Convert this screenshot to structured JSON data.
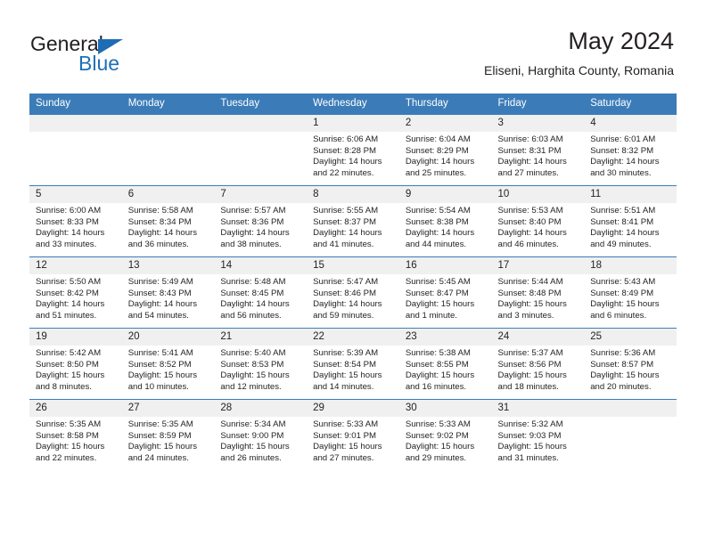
{
  "brand": {
    "name_top": "General",
    "name_bottom": "Blue"
  },
  "header": {
    "title": "May 2024",
    "subtitle": "Eliseni, Harghita County, Romania"
  },
  "colors": {
    "header_blue": "#3b7cb8",
    "brand_blue": "#1e6cb4",
    "daynum_bg": "#f0f0f0",
    "text": "#231f20"
  },
  "weekdays": [
    "Sunday",
    "Monday",
    "Tuesday",
    "Wednesday",
    "Thursday",
    "Friday",
    "Saturday"
  ],
  "weeks": [
    [
      {
        "day": "",
        "sunrise": "",
        "sunset": "",
        "daylight": "",
        "daylight2": ""
      },
      {
        "day": "",
        "sunrise": "",
        "sunset": "",
        "daylight": "",
        "daylight2": ""
      },
      {
        "day": "",
        "sunrise": "",
        "sunset": "",
        "daylight": "",
        "daylight2": ""
      },
      {
        "day": "1",
        "sunrise": "Sunrise: 6:06 AM",
        "sunset": "Sunset: 8:28 PM",
        "daylight": "Daylight: 14 hours",
        "daylight2": "and 22 minutes."
      },
      {
        "day": "2",
        "sunrise": "Sunrise: 6:04 AM",
        "sunset": "Sunset: 8:29 PM",
        "daylight": "Daylight: 14 hours",
        "daylight2": "and 25 minutes."
      },
      {
        "day": "3",
        "sunrise": "Sunrise: 6:03 AM",
        "sunset": "Sunset: 8:31 PM",
        "daylight": "Daylight: 14 hours",
        "daylight2": "and 27 minutes."
      },
      {
        "day": "4",
        "sunrise": "Sunrise: 6:01 AM",
        "sunset": "Sunset: 8:32 PM",
        "daylight": "Daylight: 14 hours",
        "daylight2": "and 30 minutes."
      }
    ],
    [
      {
        "day": "5",
        "sunrise": "Sunrise: 6:00 AM",
        "sunset": "Sunset: 8:33 PM",
        "daylight": "Daylight: 14 hours",
        "daylight2": "and 33 minutes."
      },
      {
        "day": "6",
        "sunrise": "Sunrise: 5:58 AM",
        "sunset": "Sunset: 8:34 PM",
        "daylight": "Daylight: 14 hours",
        "daylight2": "and 36 minutes."
      },
      {
        "day": "7",
        "sunrise": "Sunrise: 5:57 AM",
        "sunset": "Sunset: 8:36 PM",
        "daylight": "Daylight: 14 hours",
        "daylight2": "and 38 minutes."
      },
      {
        "day": "8",
        "sunrise": "Sunrise: 5:55 AM",
        "sunset": "Sunset: 8:37 PM",
        "daylight": "Daylight: 14 hours",
        "daylight2": "and 41 minutes."
      },
      {
        "day": "9",
        "sunrise": "Sunrise: 5:54 AM",
        "sunset": "Sunset: 8:38 PM",
        "daylight": "Daylight: 14 hours",
        "daylight2": "and 44 minutes."
      },
      {
        "day": "10",
        "sunrise": "Sunrise: 5:53 AM",
        "sunset": "Sunset: 8:40 PM",
        "daylight": "Daylight: 14 hours",
        "daylight2": "and 46 minutes."
      },
      {
        "day": "11",
        "sunrise": "Sunrise: 5:51 AM",
        "sunset": "Sunset: 8:41 PM",
        "daylight": "Daylight: 14 hours",
        "daylight2": "and 49 minutes."
      }
    ],
    [
      {
        "day": "12",
        "sunrise": "Sunrise: 5:50 AM",
        "sunset": "Sunset: 8:42 PM",
        "daylight": "Daylight: 14 hours",
        "daylight2": "and 51 minutes."
      },
      {
        "day": "13",
        "sunrise": "Sunrise: 5:49 AM",
        "sunset": "Sunset: 8:43 PM",
        "daylight": "Daylight: 14 hours",
        "daylight2": "and 54 minutes."
      },
      {
        "day": "14",
        "sunrise": "Sunrise: 5:48 AM",
        "sunset": "Sunset: 8:45 PM",
        "daylight": "Daylight: 14 hours",
        "daylight2": "and 56 minutes."
      },
      {
        "day": "15",
        "sunrise": "Sunrise: 5:47 AM",
        "sunset": "Sunset: 8:46 PM",
        "daylight": "Daylight: 14 hours",
        "daylight2": "and 59 minutes."
      },
      {
        "day": "16",
        "sunrise": "Sunrise: 5:45 AM",
        "sunset": "Sunset: 8:47 PM",
        "daylight": "Daylight: 15 hours",
        "daylight2": "and 1 minute."
      },
      {
        "day": "17",
        "sunrise": "Sunrise: 5:44 AM",
        "sunset": "Sunset: 8:48 PM",
        "daylight": "Daylight: 15 hours",
        "daylight2": "and 3 minutes."
      },
      {
        "day": "18",
        "sunrise": "Sunrise: 5:43 AM",
        "sunset": "Sunset: 8:49 PM",
        "daylight": "Daylight: 15 hours",
        "daylight2": "and 6 minutes."
      }
    ],
    [
      {
        "day": "19",
        "sunrise": "Sunrise: 5:42 AM",
        "sunset": "Sunset: 8:50 PM",
        "daylight": "Daylight: 15 hours",
        "daylight2": "and 8 minutes."
      },
      {
        "day": "20",
        "sunrise": "Sunrise: 5:41 AM",
        "sunset": "Sunset: 8:52 PM",
        "daylight": "Daylight: 15 hours",
        "daylight2": "and 10 minutes."
      },
      {
        "day": "21",
        "sunrise": "Sunrise: 5:40 AM",
        "sunset": "Sunset: 8:53 PM",
        "daylight": "Daylight: 15 hours",
        "daylight2": "and 12 minutes."
      },
      {
        "day": "22",
        "sunrise": "Sunrise: 5:39 AM",
        "sunset": "Sunset: 8:54 PM",
        "daylight": "Daylight: 15 hours",
        "daylight2": "and 14 minutes."
      },
      {
        "day": "23",
        "sunrise": "Sunrise: 5:38 AM",
        "sunset": "Sunset: 8:55 PM",
        "daylight": "Daylight: 15 hours",
        "daylight2": "and 16 minutes."
      },
      {
        "day": "24",
        "sunrise": "Sunrise: 5:37 AM",
        "sunset": "Sunset: 8:56 PM",
        "daylight": "Daylight: 15 hours",
        "daylight2": "and 18 minutes."
      },
      {
        "day": "25",
        "sunrise": "Sunrise: 5:36 AM",
        "sunset": "Sunset: 8:57 PM",
        "daylight": "Daylight: 15 hours",
        "daylight2": "and 20 minutes."
      }
    ],
    [
      {
        "day": "26",
        "sunrise": "Sunrise: 5:35 AM",
        "sunset": "Sunset: 8:58 PM",
        "daylight": "Daylight: 15 hours",
        "daylight2": "and 22 minutes."
      },
      {
        "day": "27",
        "sunrise": "Sunrise: 5:35 AM",
        "sunset": "Sunset: 8:59 PM",
        "daylight": "Daylight: 15 hours",
        "daylight2": "and 24 minutes."
      },
      {
        "day": "28",
        "sunrise": "Sunrise: 5:34 AM",
        "sunset": "Sunset: 9:00 PM",
        "daylight": "Daylight: 15 hours",
        "daylight2": "and 26 minutes."
      },
      {
        "day": "29",
        "sunrise": "Sunrise: 5:33 AM",
        "sunset": "Sunset: 9:01 PM",
        "daylight": "Daylight: 15 hours",
        "daylight2": "and 27 minutes."
      },
      {
        "day": "30",
        "sunrise": "Sunrise: 5:33 AM",
        "sunset": "Sunset: 9:02 PM",
        "daylight": "Daylight: 15 hours",
        "daylight2": "and 29 minutes."
      },
      {
        "day": "31",
        "sunrise": "Sunrise: 5:32 AM",
        "sunset": "Sunset: 9:03 PM",
        "daylight": "Daylight: 15 hours",
        "daylight2": "and 31 minutes."
      },
      {
        "day": "",
        "sunrise": "",
        "sunset": "",
        "daylight": "",
        "daylight2": ""
      }
    ]
  ]
}
